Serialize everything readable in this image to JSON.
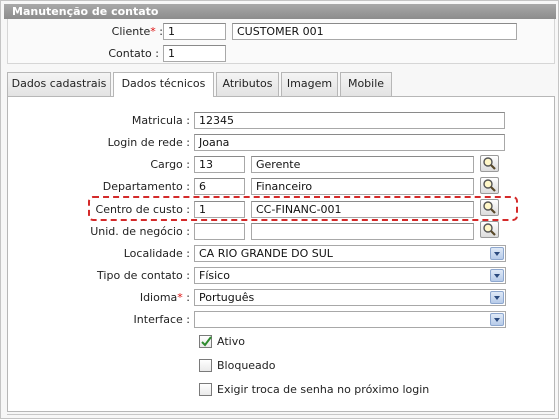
{
  "window": {
    "title": "Manutenção de contato"
  },
  "header": {
    "cliente_label": "Cliente",
    "cliente_required": "*",
    "cliente_code": "1",
    "cliente_name": "CUSTOMER 001",
    "contato_label": "Contato :",
    "contato_value": "1"
  },
  "tabs": [
    {
      "label": "Dados cadastrais",
      "active": false
    },
    {
      "label": "Dados técnicos",
      "active": true
    },
    {
      "label": "Atributos",
      "active": false
    },
    {
      "label": "Imagem",
      "active": false
    },
    {
      "label": "Mobile",
      "active": false
    }
  ],
  "form": {
    "matricula": {
      "label": "Matricula :",
      "value": "12345"
    },
    "login": {
      "label": "Login de rede :",
      "value": "Joana"
    },
    "cargo": {
      "label": "Cargo :",
      "code": "13",
      "name": "Gerente"
    },
    "departamento": {
      "label": "Departamento :",
      "code": "6",
      "name": "Financeiro"
    },
    "centro": {
      "label": "Centro de custo :",
      "code": "1",
      "name": "CC-FINANC-001"
    },
    "unid": {
      "label": "Unid. de negócio :",
      "code": "",
      "name": ""
    },
    "localidade": {
      "label": "Localidade :",
      "value": "CA RIO GRANDE DO SUL"
    },
    "tipo": {
      "label": "Tipo de contato :",
      "value": "Físico"
    },
    "idioma": {
      "label": "Idioma",
      "required": "*",
      "suffix": " :",
      "value": "Português"
    },
    "interface": {
      "label": "Interface :",
      "value": ""
    },
    "ativo": {
      "label": "Ativo",
      "checked": true
    },
    "bloqueado": {
      "label": "Bloqueado",
      "checked": false
    },
    "exigir": {
      "label": "Exigir troca de senha no próximo login",
      "checked": false
    }
  },
  "colors": {
    "highlight": "#d42a2a",
    "titlebar": "#9a9a9a",
    "required": "#dd1111",
    "check": "#2e8b2e"
  },
  "icons": {
    "search": "magnifier-icon",
    "dropdown": "chevron-down-icon",
    "check": "check-icon"
  }
}
